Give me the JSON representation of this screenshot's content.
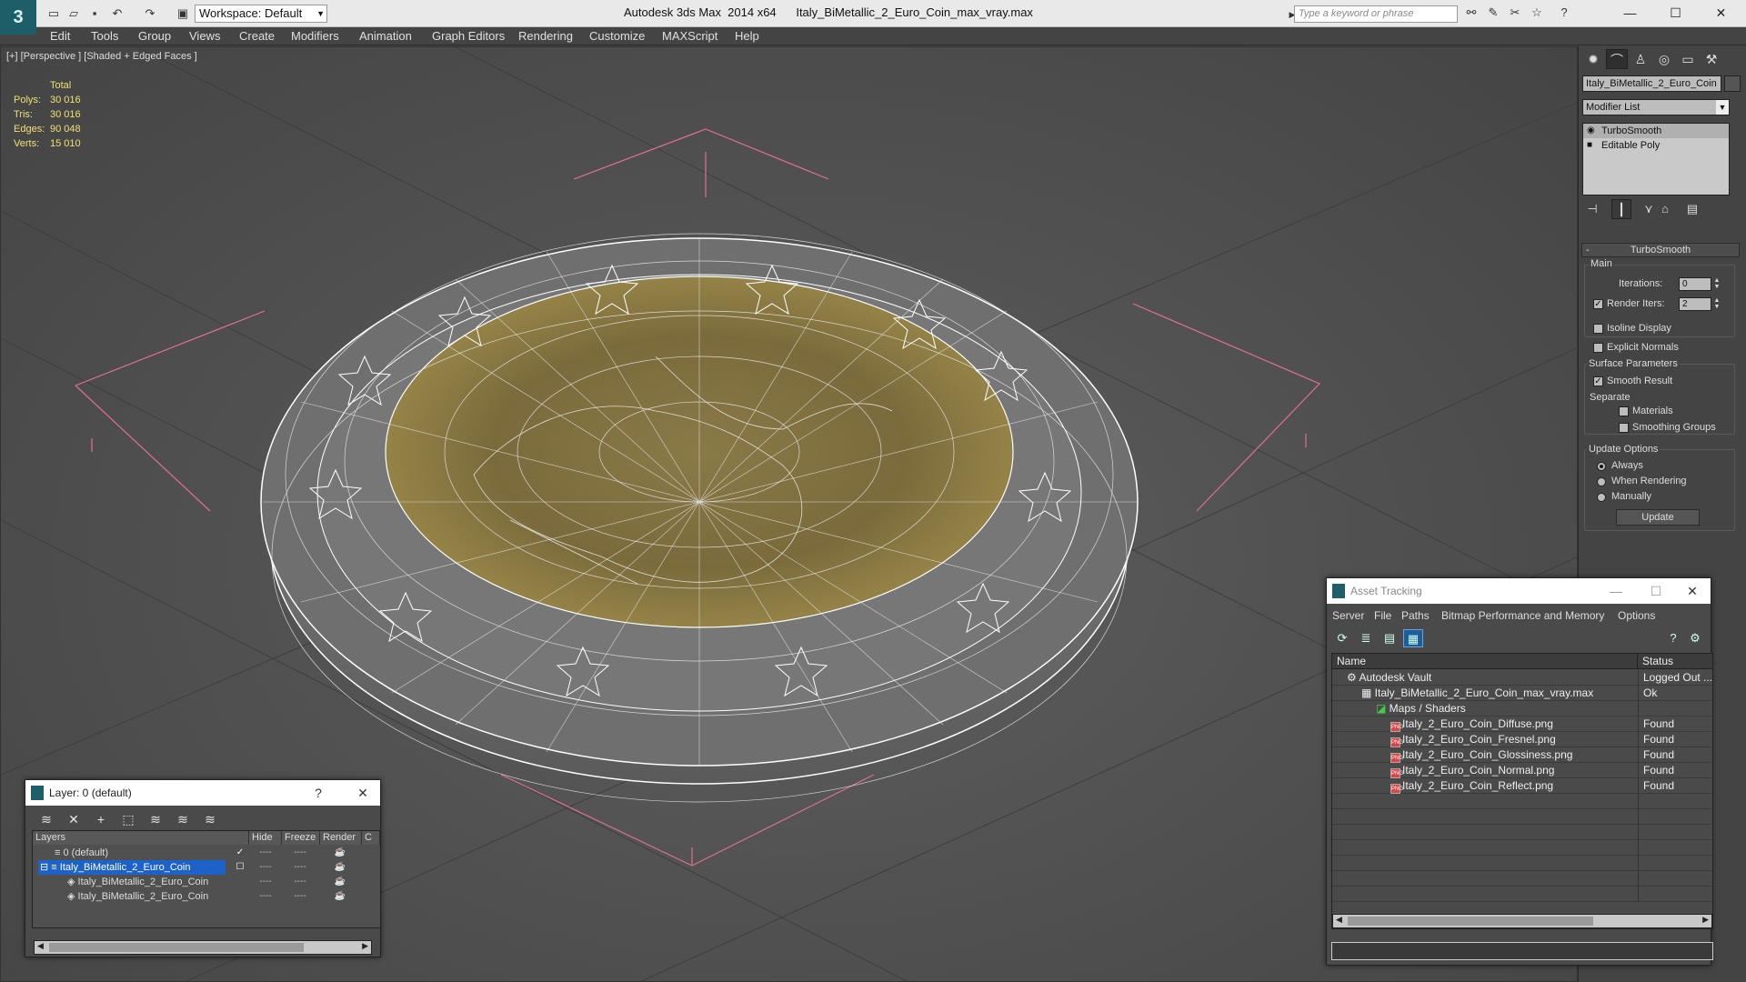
{
  "app": {
    "title": "Autodesk 3ds Max  2014 x64      Italy_BiMetallic_2_Euro_Coin_max_vray.max",
    "workspace": "Workspace: Default",
    "search_placeholder": "Type a keyword or phrase"
  },
  "menu": [
    "Edit",
    "Tools",
    "Group",
    "Views",
    "Create",
    "Modifiers",
    "Animation",
    "Graph Editors",
    "Rendering",
    "Customize",
    "MAXScript",
    "Help"
  ],
  "viewport": {
    "label": "[+] [Perspective ] [Shaded + Edged Faces ]",
    "stats_header": "Total",
    "stats": [
      {
        "k": "Polys:",
        "v": "30 016"
      },
      {
        "k": "Tris:",
        "v": "30 016"
      },
      {
        "k": "Edges:",
        "v": "90 048"
      },
      {
        "k": "Verts:",
        "v": "15 010"
      }
    ]
  },
  "command_panel": {
    "object_name": "Italy_BiMetallic_2_Euro_Coin",
    "modifier_list": "Modifier List",
    "stack": [
      "TurboSmooth",
      "Editable Poly"
    ],
    "rollout": "TurboSmooth",
    "main_group": "Main",
    "iterations_label": "Iterations:",
    "iterations_value": "0",
    "render_iters_label": "Render Iters:",
    "render_iters_value": "2",
    "isoline": "Isoline Display",
    "explicit_normals": "Explicit Normals",
    "surface_group": "Surface Parameters",
    "smooth_result": "Smooth Result",
    "separate": "Separate",
    "materials": "Materials",
    "smoothing_groups": "Smoothing Groups",
    "update_group": "Update Options",
    "always": "Always",
    "when_rendering": "When Rendering",
    "manually": "Manually",
    "update_btn": "Update"
  },
  "layer_dialog": {
    "title": "Layer: 0 (default)",
    "help": "?",
    "cols": [
      "Layers",
      "Hide",
      "Freeze",
      "Render"
    ],
    "rows": [
      {
        "name": "0 (default)",
        "check": "✓"
      },
      {
        "name": "Italy_BiMetallic_2_Euro_Coin",
        "check": ""
      },
      {
        "name": "Italy_BiMetallic_2_Euro_Coin",
        "check": ""
      },
      {
        "name": "Italy_BiMetallic_2_Euro_Coin",
        "check": ""
      }
    ],
    "dash": "----"
  },
  "asset_tracking": {
    "title": "Asset Tracking",
    "menu": [
      "Server",
      "File",
      "Paths",
      "Bitmap Performance and Memory",
      "Options"
    ],
    "cols": [
      "Name",
      "Status"
    ],
    "rows": [
      {
        "name": "Autodesk Vault",
        "status": "Logged Out ..."
      },
      {
        "name": "Italy_BiMetallic_2_Euro_Coin_max_vray.max",
        "status": "Ok"
      },
      {
        "name": "Maps / Shaders",
        "status": ""
      },
      {
        "name": "Italy_2_Euro_Coin_Diffuse.png",
        "status": "Found"
      },
      {
        "name": "Italy_2_Euro_Coin_Fresnel.png",
        "status": "Found"
      },
      {
        "name": "Italy_2_Euro_Coin_Glossiness.png",
        "status": "Found"
      },
      {
        "name": "Italy_2_Euro_Coin_Normal.png",
        "status": "Found"
      },
      {
        "name": "Italy_2_Euro_Coin_Reflect.png",
        "status": "Found"
      }
    ],
    "png": "PNG"
  },
  "colors": {
    "selection": "#1d62c8",
    "grid_pink": "#e07090",
    "stats": "#f0e070"
  }
}
